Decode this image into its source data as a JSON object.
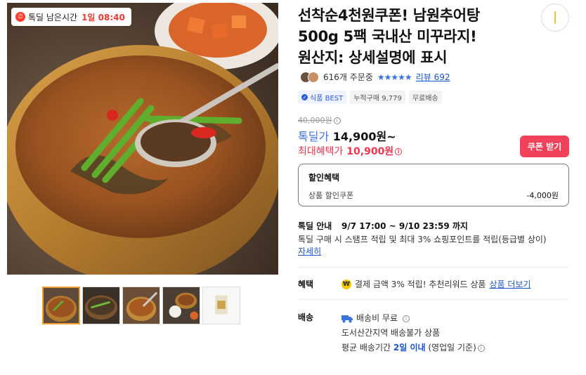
{
  "timer": {
    "label": "톡딜 남은시간",
    "time": "1일 08:40"
  },
  "product": {
    "title_lines": [
      "선착순4천원쿠폰! 남원추어탕",
      "500g 5팩 국내산 미꾸라지!",
      "원산지: 상세설명에 표시"
    ]
  },
  "rating": {
    "orders": "616개 주문중",
    "stars": "★★★★★",
    "review": "리뷰 692"
  },
  "tags": {
    "best": "식품 BEST",
    "cumulative": "누적구매 9,779",
    "free_ship": "무료배송"
  },
  "price": {
    "original": "40,000원",
    "deal_label": "톡딜가",
    "deal_value": "14,900원~",
    "best_label": "최대혜택가",
    "best_value": "10,900원",
    "coupon_button": "쿠폰 받기"
  },
  "discount": {
    "heading": "할인혜택",
    "row_label": "상품 할인쿠폰",
    "row_amount": "-4,000원"
  },
  "deal": {
    "key": "톡딜 안내",
    "period": "9/7 17:00 ~ 9/10 23:59 까지",
    "desc": "톡딜 구매 시 스탬프 적립 및 최대 3% 쇼핑포인트를 적립(등급별 상이)",
    "detail_link": "자세히"
  },
  "benefit": {
    "key": "혜택",
    "text": "결제 금액 3% 적립! 추천리워드 상품",
    "link": "상품 더보기",
    "coin": "₩"
  },
  "shipping": {
    "key": "배송",
    "fee": "배송비 무료",
    "note": "도서산간지역 배송불가 상품",
    "avg_prefix": "평균 배송기간",
    "avg_value": "2일 이내",
    "avg_suffix": "(영업일 기준)"
  },
  "icons": {
    "timer": "clock-icon",
    "share": "share-icon",
    "info": "info-icon",
    "truck": "truck-icon",
    "coin": "won-coin-icon"
  },
  "colors": {
    "accent_blue": "#3a73e0",
    "accent_red": "#f0364e",
    "coupon_bg": "#f0435a",
    "active_thumb": "#f0a030"
  }
}
